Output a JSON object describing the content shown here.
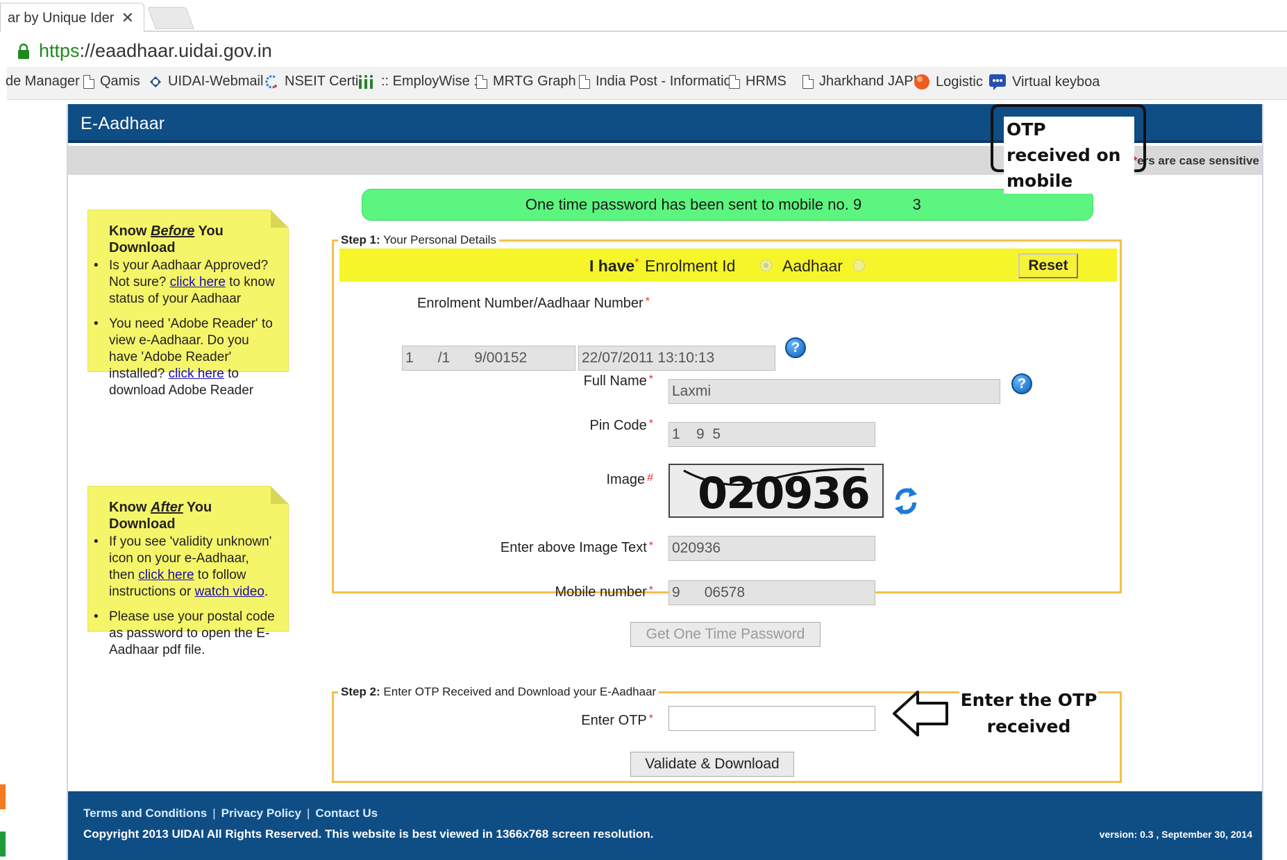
{
  "browser": {
    "tab_title": "ar by Unique Ider",
    "tab_close": "✕",
    "url_scheme": "https",
    "url_rest": "://eaadhaar.uidai.gov.in",
    "bookmarks": [
      "de Manager",
      "Qamis",
      "UIDAI-Webmail",
      "NSEIT Certi",
      ":: EmployWise ::",
      "MRTG Graph",
      "India Post - Informatic",
      "HRMS",
      "Jharkhand JAPIT",
      "Logistic",
      "Virtual keyboa"
    ]
  },
  "header": {
    "title": "E-Aadhaar",
    "case_note_star": "*",
    "case_note_text": "ers are case sensitive"
  },
  "otp_banner": "One time password has been sent to mobile no. 9      3 ",
  "know_before": {
    "heading_pre": "Know ",
    "heading_em": "Before",
    "heading_post": " You Download",
    "item1_pre": "Is your Aadhaar Approved? Not sure? ",
    "item1_link": "click here",
    "item1_post": " to know status of your Aadhaar",
    "item2_pre": "You need 'Adobe Reader' to view e-Aadhaar. Do you have 'Adobe Reader' installed? ",
    "item2_link": "click here",
    "item2_post": " to download Adobe Reader"
  },
  "know_after": {
    "heading_pre": "Know ",
    "heading_em": "After",
    "heading_post": " You Download",
    "item1_pre": "If you see 'validity unknown' icon on your e-Aadhaar, then ",
    "item1_link": "click here",
    "item1_mid": " to follow instructions or ",
    "item1_link2": "watch video",
    "item1_post": ".",
    "item2": "Please use your postal code as password to open the E-Aadhaar pdf file."
  },
  "step1": {
    "legend_bold": "Step 1:",
    "legend_text": " Your Personal Details",
    "i_have": "I have",
    "req": "*",
    "opt_enrolment": "Enrolment Id",
    "opt_aadhaar": "Aadhaar",
    "reset": "Reset",
    "enrolment_label": "Enrolment Number/Aadhaar Number",
    "enrolment_value": "1   /1   9/00152",
    "date_value": "22/07/2011 13:10:13",
    "fullname_label": "Full Name",
    "fullname_value": "Laxmi",
    "pincode_label": "Pin Code",
    "pincode_value": "1  9 5 ",
    "image_label": "Image",
    "image_req": "#",
    "captcha_text": "020936",
    "image_text_label": "Enter above Image Text",
    "image_text_value": "020936",
    "mobile_label": "Mobile number",
    "mobile_value": "9   06578 ",
    "get_otp": "Get One Time Password"
  },
  "step2": {
    "legend_bold": "Step 2:",
    "legend_text": " Enter OTP Received and Download your E-Aadhaar",
    "otp_label": "Enter OTP",
    "otp_value": "",
    "validate": "Validate & Download"
  },
  "footer": {
    "terms": "Terms and Conditions",
    "privacy": "Privacy Policy",
    "contact": "Contact Us",
    "sep": "|",
    "copyright": "Copyright 2013 UIDAI All Rights Reserved. This website is best viewed in 1366x768 screen resolution.",
    "version": "version: 0.3 , September 30, 2014"
  },
  "annotations": {
    "otp_received": "OTP received on mobile",
    "enter_otp": "Enter the OTP received"
  },
  "colors": {
    "header_blue": "#0f4d85",
    "note_yellow": "#f5f56a",
    "banner_green": "#5cf57f",
    "step_border": "#f5c04a"
  }
}
